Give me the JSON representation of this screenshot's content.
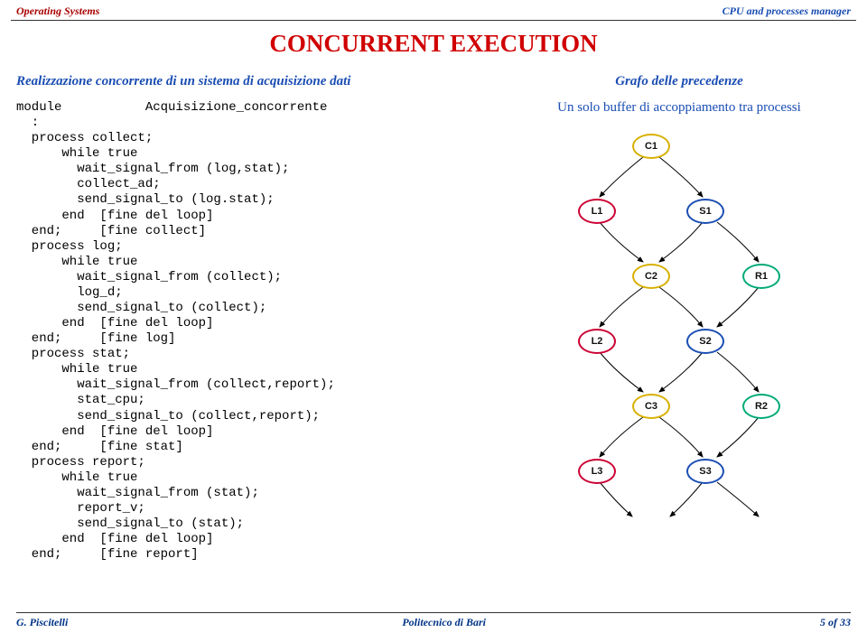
{
  "header": {
    "left": "Operating Systems",
    "right": "CPU and processes manager"
  },
  "title": "CONCURRENT EXECUTION",
  "left": {
    "subtitle": "Realizzazione concorrente di un sistema di acquisizione dati",
    "code": "module           Acquisizione_concorrente\n  :\n  process collect;\n      while true\n        wait_signal_from (log,stat);\n        collect_ad;\n        send_signal_to (log.stat);\n      end  [fine del loop]\n  end;     [fine collect]\n  process log;\n      while true\n        wait_signal_from (collect);\n        log_d;\n        send_signal_to (collect);\n      end  [fine del loop]\n  end;     [fine log]\n  process stat;\n      while true\n        wait_signal_from (collect,report);\n        stat_cpu;\n        send_signal_to (collect,report);\n      end  [fine del loop]\n  end;     [fine stat]\n  process report;\n      while true\n        wait_signal_from (stat);\n        report_v;\n        send_signal_to (stat);\n      end  [fine del loop]\n  end;     [fine report]"
  },
  "right": {
    "subtitle": "Grafo delle precedenze",
    "subdesc": "Un solo buffer di accoppiamento tra processi",
    "nodes": {
      "c1": "C1",
      "l1": "L1",
      "s1": "S1",
      "c2": "C2",
      "r1": "R1",
      "l2": "L2",
      "s2": "S2",
      "c3": "C3",
      "r2": "R2",
      "l3": "L3",
      "s3": "S3"
    }
  },
  "footer": {
    "left": "G. Piscitelli",
    "center": "Politecnico di Bari",
    "right": "5 of 33"
  }
}
